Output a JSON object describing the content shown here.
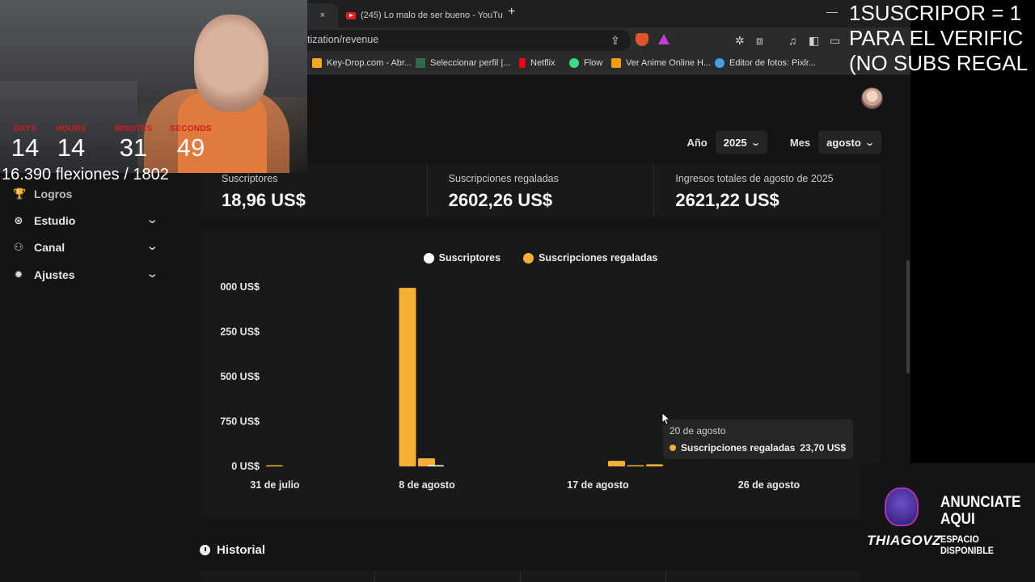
{
  "browser": {
    "active_tab_close": "×",
    "tabs": [
      {
        "title": "(245) Lo malo de ser bueno - YouTub"
      }
    ],
    "new_tab": "+",
    "minimize": "—",
    "url": "tization/revenue",
    "bookmarks": [
      {
        "label": "Key-Drop.com - Abr...",
        "icon": "key-drop-icon",
        "color": "#f5a623"
      },
      {
        "label": "Seleccionar perfil |...",
        "icon": "profile-icon",
        "color": "#2f6b4a"
      },
      {
        "label": "Netflix",
        "icon": "netflix-icon",
        "color": "#e50914"
      },
      {
        "label": "Flow",
        "icon": "flow-icon",
        "color": "#3ddc84"
      },
      {
        "label": "Ver Anime Online H...",
        "icon": "anime-icon",
        "color": "#f39c12"
      },
      {
        "label": "Editor de fotos: Pixlr...",
        "icon": "pixlr-icon",
        "color": "#3aa3e3"
      }
    ]
  },
  "sidebar": {
    "items": [
      {
        "label": "Logros",
        "icon": "trophy-icon"
      },
      {
        "label": "Estudio",
        "icon": "studio-icon"
      },
      {
        "label": "Canal",
        "icon": "channel-icon"
      },
      {
        "label": "Ajustes",
        "icon": "gear-icon"
      }
    ]
  },
  "filters": {
    "year_label": "Año",
    "year_value": "2025",
    "month_label": "Mes",
    "month_value": "agosto"
  },
  "stats": [
    {
      "label": "Suscriptores",
      "value": "18,96 US$"
    },
    {
      "label": "Suscripciones regaladas",
      "value": "2602,26 US$"
    },
    {
      "label": "Ingresos totales de agosto de 2025",
      "value": "2621,22 US$"
    }
  ],
  "chart_data": {
    "type": "bar",
    "series": [
      {
        "name": "Suscriptores",
        "color": "#ffffff"
      },
      {
        "name": "Suscripciones regaladas",
        "color": "#f5b033"
      }
    ],
    "y_tick_labels": [
      "000 US$",
      "250 US$",
      "500 US$",
      "750 US$",
      "0 US$"
    ],
    "x_tick_labels": [
      "31 de julio",
      "8 de agosto",
      "17 de agosto",
      "26 de agosto"
    ],
    "bars": [
      {
        "date": "31 de julio",
        "series": "Suscripciones regaladas",
        "value": 2.5
      },
      {
        "date": "7 de agosto",
        "series": "Suscripciones regaladas",
        "value": 1990
      },
      {
        "date": "8 de agosto",
        "series": "Suscripciones regaladas",
        "value": 90
      },
      {
        "date": "8 de agosto",
        "series": "Suscriptores",
        "value": 1.5
      },
      {
        "date": "18 de agosto",
        "series": "Suscripciones regaladas",
        "value": 62
      },
      {
        "date": "19 de agosto",
        "series": "Suscripciones regaladas",
        "value": 4
      },
      {
        "date": "20 de agosto",
        "series": "Suscripciones regaladas",
        "value": 23.7
      }
    ],
    "tooltip": {
      "title": "20 de agosto",
      "series": "Suscripciones regaladas",
      "value": "23,70 US$"
    },
    "legend_position": "top-center",
    "grid": false
  },
  "history": {
    "title": "Historial"
  },
  "overlay": {
    "timer": [
      {
        "unit": "DAYS",
        "value": "14"
      },
      {
        "unit": "HOURS",
        "value": "14"
      },
      {
        "unit": "MINUTES",
        "value": "31"
      },
      {
        "unit": "SECONDS",
        "value": "49"
      }
    ],
    "pushups": "16.390 flexiones / 1802",
    "promo_lines": [
      "1SUSCRIPOR = 1",
      "PARA EL VERIFIC",
      "(NO SUBS REGAL"
    ],
    "ad": {
      "logo_text": "THIAGOVZ",
      "title": [
        "ANUNCIATE",
        "AQUI"
      ],
      "subtitle": [
        "ESPACIO",
        "DISPONIBLE"
      ]
    }
  }
}
